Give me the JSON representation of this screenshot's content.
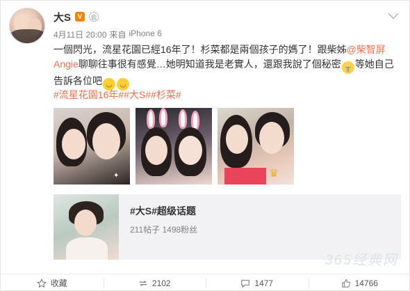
{
  "post": {
    "username": "大S",
    "vip_badge": "V",
    "member_badge": "会",
    "date": "4月11日 20:00",
    "source_prefix": "来自",
    "device": "iPhone 6",
    "text_line1_a": "一個閃光，流星花園已經16年了！杉菜都是兩個孩子的媽了！跟柴姊",
    "mention": "@柴智屏Angie",
    "text_line2_b": "聊聊往事很有感覺…她明知道我是老實人，還跟我說了個秘密",
    "text_line2_c": "等她自己告訴各位吧",
    "hashtags": "#流星花園16年##大S##杉菜#",
    "emoji_cry": "cry-emoji",
    "emoji_tongue": "tongue-emoji"
  },
  "topic": {
    "title": "#大S#超级话题",
    "stats": "211帖子 1498粉丝"
  },
  "watermark": "365经典网",
  "actions": {
    "favorite_label": "收藏",
    "repost_count": "2102",
    "comment_count": "1477",
    "like_count": "14766"
  },
  "colors": {
    "link": "#eb7350",
    "vip": "#ff8200",
    "text": "#333333",
    "meta": "#808080"
  }
}
